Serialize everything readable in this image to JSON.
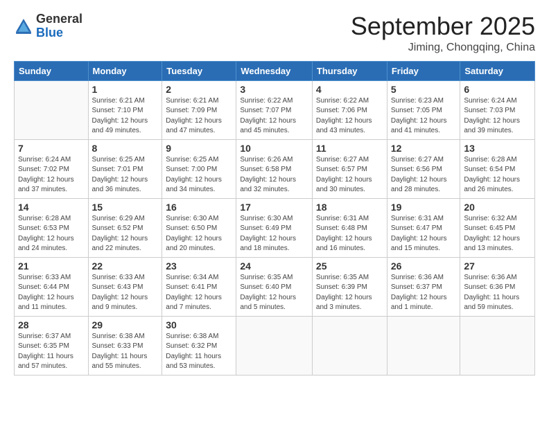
{
  "logo": {
    "general": "General",
    "blue": "Blue"
  },
  "header": {
    "month": "September 2025",
    "location": "Jiming, Chongqing, China"
  },
  "days_of_week": [
    "Sunday",
    "Monday",
    "Tuesday",
    "Wednesday",
    "Thursday",
    "Friday",
    "Saturday"
  ],
  "weeks": [
    [
      {
        "day": "",
        "info": ""
      },
      {
        "day": "1",
        "info": "Sunrise: 6:21 AM\nSunset: 7:10 PM\nDaylight: 12 hours\nand 49 minutes."
      },
      {
        "day": "2",
        "info": "Sunrise: 6:21 AM\nSunset: 7:09 PM\nDaylight: 12 hours\nand 47 minutes."
      },
      {
        "day": "3",
        "info": "Sunrise: 6:22 AM\nSunset: 7:07 PM\nDaylight: 12 hours\nand 45 minutes."
      },
      {
        "day": "4",
        "info": "Sunrise: 6:22 AM\nSunset: 7:06 PM\nDaylight: 12 hours\nand 43 minutes."
      },
      {
        "day": "5",
        "info": "Sunrise: 6:23 AM\nSunset: 7:05 PM\nDaylight: 12 hours\nand 41 minutes."
      },
      {
        "day": "6",
        "info": "Sunrise: 6:24 AM\nSunset: 7:03 PM\nDaylight: 12 hours\nand 39 minutes."
      }
    ],
    [
      {
        "day": "7",
        "info": "Sunrise: 6:24 AM\nSunset: 7:02 PM\nDaylight: 12 hours\nand 37 minutes."
      },
      {
        "day": "8",
        "info": "Sunrise: 6:25 AM\nSunset: 7:01 PM\nDaylight: 12 hours\nand 36 minutes."
      },
      {
        "day": "9",
        "info": "Sunrise: 6:25 AM\nSunset: 7:00 PM\nDaylight: 12 hours\nand 34 minutes."
      },
      {
        "day": "10",
        "info": "Sunrise: 6:26 AM\nSunset: 6:58 PM\nDaylight: 12 hours\nand 32 minutes."
      },
      {
        "day": "11",
        "info": "Sunrise: 6:27 AM\nSunset: 6:57 PM\nDaylight: 12 hours\nand 30 minutes."
      },
      {
        "day": "12",
        "info": "Sunrise: 6:27 AM\nSunset: 6:56 PM\nDaylight: 12 hours\nand 28 minutes."
      },
      {
        "day": "13",
        "info": "Sunrise: 6:28 AM\nSunset: 6:54 PM\nDaylight: 12 hours\nand 26 minutes."
      }
    ],
    [
      {
        "day": "14",
        "info": "Sunrise: 6:28 AM\nSunset: 6:53 PM\nDaylight: 12 hours\nand 24 minutes."
      },
      {
        "day": "15",
        "info": "Sunrise: 6:29 AM\nSunset: 6:52 PM\nDaylight: 12 hours\nand 22 minutes."
      },
      {
        "day": "16",
        "info": "Sunrise: 6:30 AM\nSunset: 6:50 PM\nDaylight: 12 hours\nand 20 minutes."
      },
      {
        "day": "17",
        "info": "Sunrise: 6:30 AM\nSunset: 6:49 PM\nDaylight: 12 hours\nand 18 minutes."
      },
      {
        "day": "18",
        "info": "Sunrise: 6:31 AM\nSunset: 6:48 PM\nDaylight: 12 hours\nand 16 minutes."
      },
      {
        "day": "19",
        "info": "Sunrise: 6:31 AM\nSunset: 6:47 PM\nDaylight: 12 hours\nand 15 minutes."
      },
      {
        "day": "20",
        "info": "Sunrise: 6:32 AM\nSunset: 6:45 PM\nDaylight: 12 hours\nand 13 minutes."
      }
    ],
    [
      {
        "day": "21",
        "info": "Sunrise: 6:33 AM\nSunset: 6:44 PM\nDaylight: 12 hours\nand 11 minutes."
      },
      {
        "day": "22",
        "info": "Sunrise: 6:33 AM\nSunset: 6:43 PM\nDaylight: 12 hours\nand 9 minutes."
      },
      {
        "day": "23",
        "info": "Sunrise: 6:34 AM\nSunset: 6:41 PM\nDaylight: 12 hours\nand 7 minutes."
      },
      {
        "day": "24",
        "info": "Sunrise: 6:35 AM\nSunset: 6:40 PM\nDaylight: 12 hours\nand 5 minutes."
      },
      {
        "day": "25",
        "info": "Sunrise: 6:35 AM\nSunset: 6:39 PM\nDaylight: 12 hours\nand 3 minutes."
      },
      {
        "day": "26",
        "info": "Sunrise: 6:36 AM\nSunset: 6:37 PM\nDaylight: 12 hours\nand 1 minute."
      },
      {
        "day": "27",
        "info": "Sunrise: 6:36 AM\nSunset: 6:36 PM\nDaylight: 11 hours\nand 59 minutes."
      }
    ],
    [
      {
        "day": "28",
        "info": "Sunrise: 6:37 AM\nSunset: 6:35 PM\nDaylight: 11 hours\nand 57 minutes."
      },
      {
        "day": "29",
        "info": "Sunrise: 6:38 AM\nSunset: 6:33 PM\nDaylight: 11 hours\nand 55 minutes."
      },
      {
        "day": "30",
        "info": "Sunrise: 6:38 AM\nSunset: 6:32 PM\nDaylight: 11 hours\nand 53 minutes."
      },
      {
        "day": "",
        "info": ""
      },
      {
        "day": "",
        "info": ""
      },
      {
        "day": "",
        "info": ""
      },
      {
        "day": "",
        "info": ""
      }
    ]
  ]
}
